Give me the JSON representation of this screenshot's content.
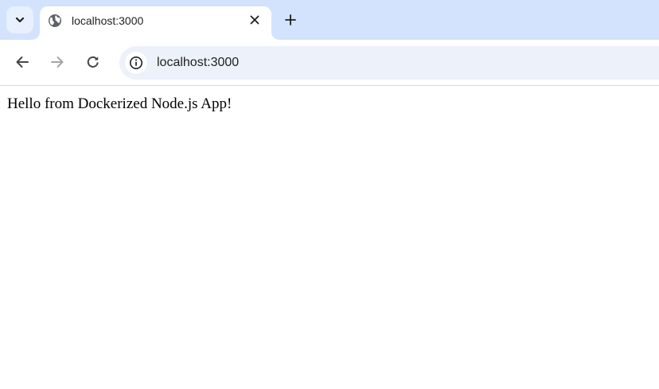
{
  "browser": {
    "tab": {
      "title": "localhost:3000",
      "favicon": "globe-icon"
    },
    "icons": {
      "tab_search": "chevron-down-icon",
      "tab_close": "close-icon",
      "new_tab": "plus-icon",
      "back": "arrow-back-icon",
      "forward": "arrow-forward-icon",
      "reload": "reload-icon",
      "site_info": "info-icon"
    },
    "address_bar": {
      "url": "localhost:3000"
    },
    "colors": {
      "tabstrip": "#d3e3fd",
      "omnibox": "#ecf1fa",
      "active_icon": "#474747",
      "disabled_icon": "#a5a5a5"
    }
  },
  "page": {
    "body_text": "Hello from Dockerized Node.js App!"
  }
}
